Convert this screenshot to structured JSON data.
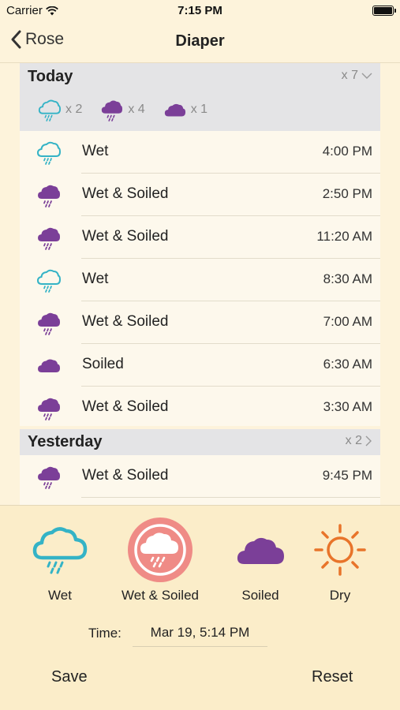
{
  "status": {
    "carrier": "Carrier",
    "time": "7:15 PM"
  },
  "nav": {
    "back_label": "Rose",
    "title": "Diaper"
  },
  "today": {
    "title": "Today",
    "count": "x 7",
    "summary": [
      {
        "icon": "wet-icon",
        "count": "x 2"
      },
      {
        "icon": "wet-soiled-icon",
        "count": "x 4"
      },
      {
        "icon": "soiled-icon",
        "count": "x 1"
      }
    ],
    "entries": [
      {
        "type": "wet",
        "label": "Wet",
        "time": "4:00 PM"
      },
      {
        "type": "wet-soiled",
        "label": "Wet & Soiled",
        "time": "2:50 PM"
      },
      {
        "type": "wet-soiled",
        "label": "Wet & Soiled",
        "time": "11:20 AM"
      },
      {
        "type": "wet",
        "label": "Wet",
        "time": "8:30 AM"
      },
      {
        "type": "wet-soiled",
        "label": "Wet & Soiled",
        "time": "7:00 AM"
      },
      {
        "type": "soiled",
        "label": "Soiled",
        "time": "6:30 AM"
      },
      {
        "type": "wet-soiled",
        "label": "Wet & Soiled",
        "time": "3:30 AM"
      }
    ]
  },
  "yesterday": {
    "title": "Yesterday",
    "count": "x 2",
    "entries": [
      {
        "type": "wet-soiled",
        "label": "Wet & Soiled",
        "time": "9:45 PM"
      }
    ]
  },
  "types": [
    {
      "key": "wet",
      "label": "Wet",
      "selected": false
    },
    {
      "key": "wet-soiled",
      "label": "Wet & Soiled",
      "selected": true
    },
    {
      "key": "soiled",
      "label": "Soiled",
      "selected": false
    },
    {
      "key": "dry",
      "label": "Dry",
      "selected": false
    }
  ],
  "time_field": {
    "label": "Time:",
    "value": "Mar 19, 5:14 PM"
  },
  "actions": {
    "save": "Save",
    "reset": "Reset"
  },
  "colors": {
    "wet": "#34B3C6",
    "wet_soiled": "#7B3F98",
    "soiled": "#7B3F98",
    "dry": "#E8742A",
    "selected_bg": "#EF8B86"
  }
}
